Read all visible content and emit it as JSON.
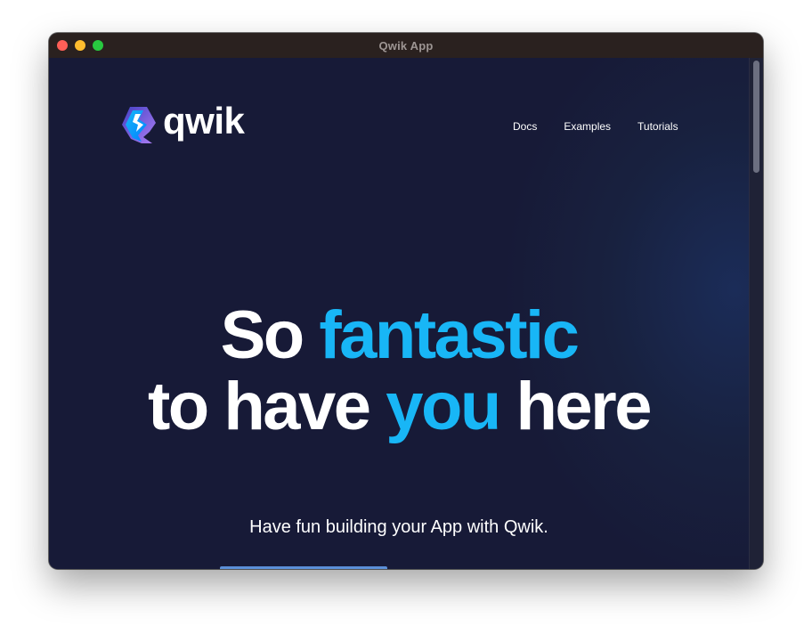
{
  "window": {
    "title": "Qwik App"
  },
  "logo": {
    "text": "qwik"
  },
  "nav": {
    "items": [
      "Docs",
      "Examples",
      "Tutorials"
    ]
  },
  "hero": {
    "line1_plain": "So ",
    "line1_accent": "fantastic",
    "line2_plain_start": "to have ",
    "line2_accent": "you",
    "line2_plain_end": " here"
  },
  "subtitle": "Have fun building your App with Qwik.",
  "colors": {
    "background": "#171a37",
    "accent": "#18b6f6",
    "titlebar": "#2a211f",
    "logo_purple": "#ac7ef4",
    "logo_blue": "#18b6f6"
  }
}
